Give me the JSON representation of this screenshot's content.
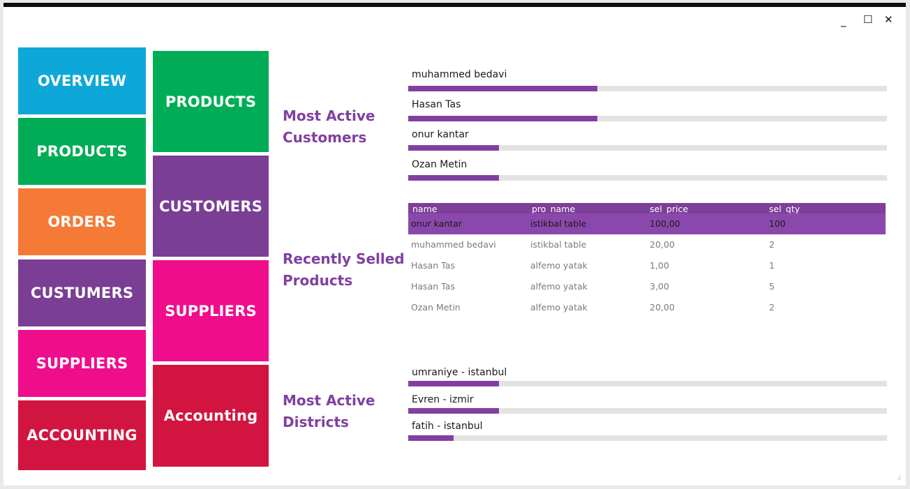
{
  "window": {
    "minimize": "_",
    "maximize": "☐",
    "close": "✕"
  },
  "colors": {
    "blue": "#0ea8d8",
    "green": "#00ad56",
    "orange": "#f47a35",
    "purple": "#7a3e94",
    "pink": "#f00d8c",
    "red": "#d21540",
    "accent": "#8040a0"
  },
  "nav_left": [
    {
      "label": "OVERVIEW",
      "color": "#0ea8d8"
    },
    {
      "label": "PRODUCTS",
      "color": "#00ad56"
    },
    {
      "label": "ORDERS",
      "color": "#f47a35"
    },
    {
      "label": "CUSTUMERS",
      "color": "#7a3e94"
    },
    {
      "label": "SUPPLIERS",
      "color": "#f00d8c"
    },
    {
      "label": "ACCOUNTING",
      "color": "#d21540"
    }
  ],
  "nav_right": [
    {
      "label": "PRODUCTS",
      "color": "#00ad56"
    },
    {
      "label": "CUSTOMERS",
      "color": "#7a3e94"
    },
    {
      "label": "SUPPLIERS",
      "color": "#f00d8c"
    },
    {
      "label": "Accounting",
      "color": "#d21540"
    }
  ],
  "customers": {
    "title_line1": "Most Active",
    "title_line2": "Customers",
    "bar_color": "#8040a0",
    "items": [
      {
        "name": "muhammed bedavi",
        "fill": 0.395
      },
      {
        "name": "Hasan Tas",
        "fill": 0.395
      },
      {
        "name": "onur kantar",
        "fill": 0.19
      },
      {
        "name": "Ozan Metin",
        "fill": 0.19
      }
    ]
  },
  "products": {
    "title_line1": "Recently Selled",
    "title_line2": "Products",
    "columns": [
      "name",
      "pro_name",
      "sel_price",
      "sel_qty"
    ],
    "rows": [
      [
        "onur kantar",
        "istikbal table",
        "100,00",
        "100"
      ],
      [
        "muhammed bedavi",
        "istikbal table",
        "20,00",
        "2"
      ],
      [
        "Hasan Tas",
        "alfemo yatak",
        "1,00",
        "1"
      ],
      [
        "Hasan Tas",
        "alfemo yatak",
        "3,00",
        "5"
      ],
      [
        "Ozan Metin",
        "alfemo yatak",
        "20,00",
        "2"
      ]
    ],
    "selected_row": 0
  },
  "districts": {
    "title_line1": "Most Active",
    "title_line2": "Districts",
    "bar_color": "#8040a0",
    "items": [
      {
        "name": "umraniye - istanbul",
        "fill": 0.19
      },
      {
        "name": "Evren - izmir",
        "fill": 0.19
      },
      {
        "name": "fatih - istanbul",
        "fill": 0.095
      }
    ]
  }
}
